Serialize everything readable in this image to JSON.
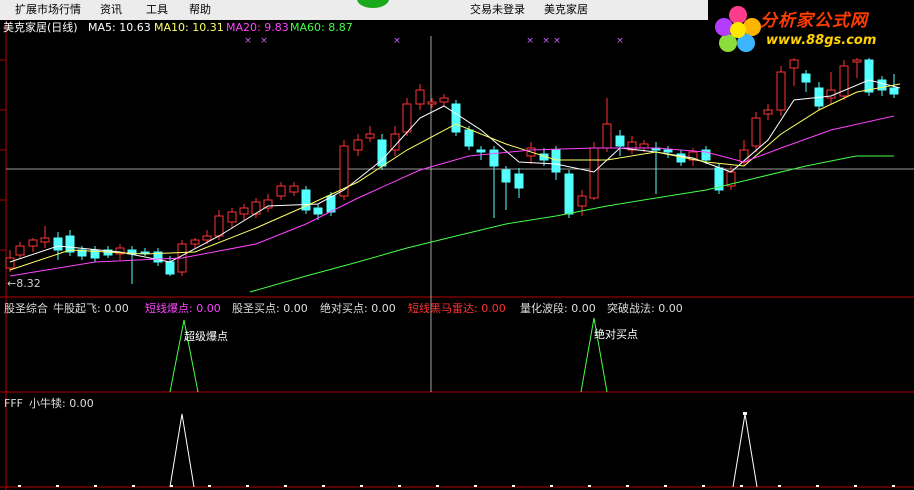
{
  "menu": {
    "items": [
      "扩展市场行情",
      "资讯",
      "工具",
      "帮助"
    ],
    "trade_status": "交易未登录",
    "stock_name": "美克家居"
  },
  "logo": {
    "text": "分析家公式网",
    "url": "www.88gs.com"
  },
  "main_panel": {
    "title": "美克家居(日线)",
    "ma5": "MA5: 10.63",
    "ma10": "MA10: 10.31",
    "ma20": "MA20: 9.83",
    "ma60": "MA60: 8.87",
    "low_mark": "8.32"
  },
  "indicator_panel": {
    "name": "股圣综合",
    "labels": [
      "牛股起飞: 0.00",
      "短线爆点: 0.00",
      "股圣买点: 0.00",
      "绝对买点: 0.00",
      "短线黑马雷达: 0.00",
      "量化波段: 0.00",
      "突破战法: 0.00"
    ],
    "annotation_1": "超级爆点",
    "annotation_2": "绝对买点"
  },
  "fff_panel": {
    "name": "FFF",
    "label": "小牛犊: 0.00"
  },
  "colors": {
    "up": "#ff3232",
    "down": "#54ffff",
    "ma5": "#ffffff",
    "ma10": "#ffff66",
    "ma20": "#ff44ff",
    "ma60": "#44ff44",
    "frame": "#b40000"
  }
}
